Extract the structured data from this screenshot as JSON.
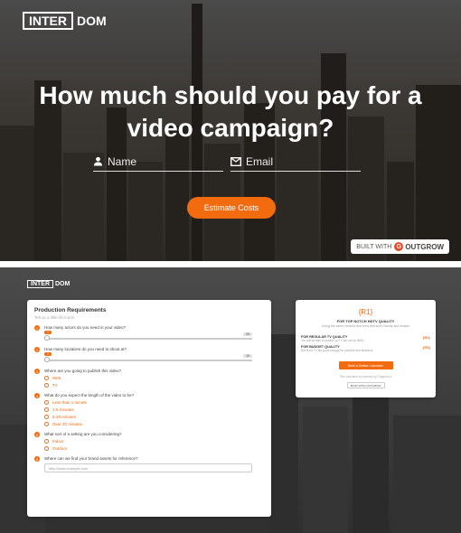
{
  "hero": {
    "logo_left": "INTER",
    "logo_right": "DOM",
    "title": "How much should you pay for a video campaign?",
    "name_placeholder": "Name",
    "email_placeholder": "Email",
    "cta": "Estimate Costs",
    "built_with": "BUILT WITH",
    "outgrow": "OUTGROW",
    "outgrow_mark": "G"
  },
  "calc": {
    "logo_left": "INTER",
    "logo_right": "DOM",
    "title": "Production Requirements",
    "subtitle": "Tell us a little bit more!",
    "questions": [
      {
        "num": "1",
        "text": "How many actors do you need in your video?",
        "slider": {
          "value": "1",
          "max": "20",
          "fraction": 0
        }
      },
      {
        "num": "2",
        "text": "How many locations do you need to shoot at?",
        "slider": {
          "value": "1",
          "max": "10",
          "fraction": 0
        }
      },
      {
        "num": "3",
        "text": "Where are you going to publish this video?",
        "options": [
          "Web",
          "TV"
        ]
      },
      {
        "num": "4",
        "text": "What do you expect the length of the video to be?",
        "options": [
          "Less than 1 minute",
          "1-5 minutes",
          "5-20 minutes",
          "Over 20 minutes"
        ]
      },
      {
        "num": "5",
        "text": "What sort of a setting are you considering?",
        "options": [
          "Indoor",
          "Outdoor"
        ]
      },
      {
        "num": "6",
        "text": "Where can we find your brand assets for reference?",
        "input_placeholder": "http://www.example.com"
      }
    ]
  },
  "result": {
    "price": "{R1}",
    "heading": "FOR TOP NOTCH HDTV QUALITY",
    "sub": "Using the same camera and crew that shot Gravity and Avatar!",
    "rows": [
      {
        "label": "FOR REGULAR TV QUALITY",
        "desc": "You will be able to publish on TV but not on IMAX",
        "value": "{R2}"
      },
      {
        "label": "FOR BUDGET QUALITY",
        "desc": "Not fit for TV but good enough for youtube and facebook",
        "value": "{R3}"
      }
    ],
    "button": "Build a Similar Calculator",
    "note": "This calculator is powered by Outgrow.co",
    "badge": "BUILT WITH OUTGROW"
  },
  "colors": {
    "accent": "#f26b0f"
  }
}
